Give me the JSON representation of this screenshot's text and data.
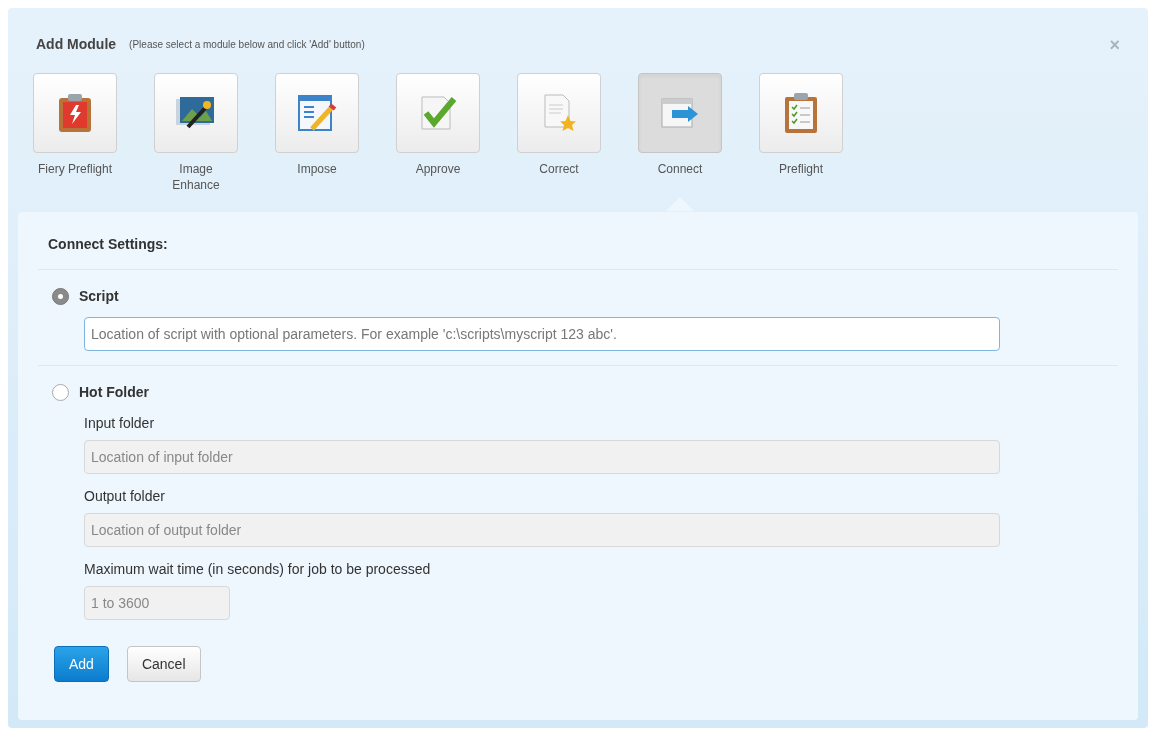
{
  "dialog": {
    "title": "Add Module",
    "hint": "(Please select a module below and click 'Add' button)",
    "close": "×"
  },
  "modules": [
    {
      "label": "Fiery Preflight",
      "kind": "fiery",
      "selected": false
    },
    {
      "label": "Image Enhance",
      "kind": "image",
      "selected": false
    },
    {
      "label": "Impose",
      "kind": "impose",
      "selected": false
    },
    {
      "label": "Approve",
      "kind": "approve",
      "selected": false
    },
    {
      "label": "Correct",
      "kind": "correct",
      "selected": false
    },
    {
      "label": "Connect",
      "kind": "connect",
      "selected": true
    },
    {
      "label": "Preflight",
      "kind": "preflight",
      "selected": false
    }
  ],
  "settings": {
    "heading": "Connect Settings:",
    "options": [
      {
        "label": "Script",
        "selected": true,
        "fields": [
          {
            "placeholder": "Location of script with optional parameters. For example 'c:\\scripts\\myscript 123 abc'.",
            "disabled": false
          }
        ]
      },
      {
        "label": "Hot Folder",
        "selected": false,
        "fields": [
          {
            "label": "Input folder",
            "placeholder": "Location of input folder",
            "disabled": true
          },
          {
            "label": "Output folder",
            "placeholder": "Location of output folder",
            "disabled": true
          },
          {
            "label": "Maximum wait time (in seconds) for job to be processed",
            "placeholder": "1 to 3600",
            "disabled": true,
            "kind": "short"
          }
        ]
      }
    ]
  },
  "buttons": [
    {
      "label": "Add",
      "kind": "primary"
    },
    {
      "label": "Cancel",
      "kind": "secondary"
    }
  ]
}
